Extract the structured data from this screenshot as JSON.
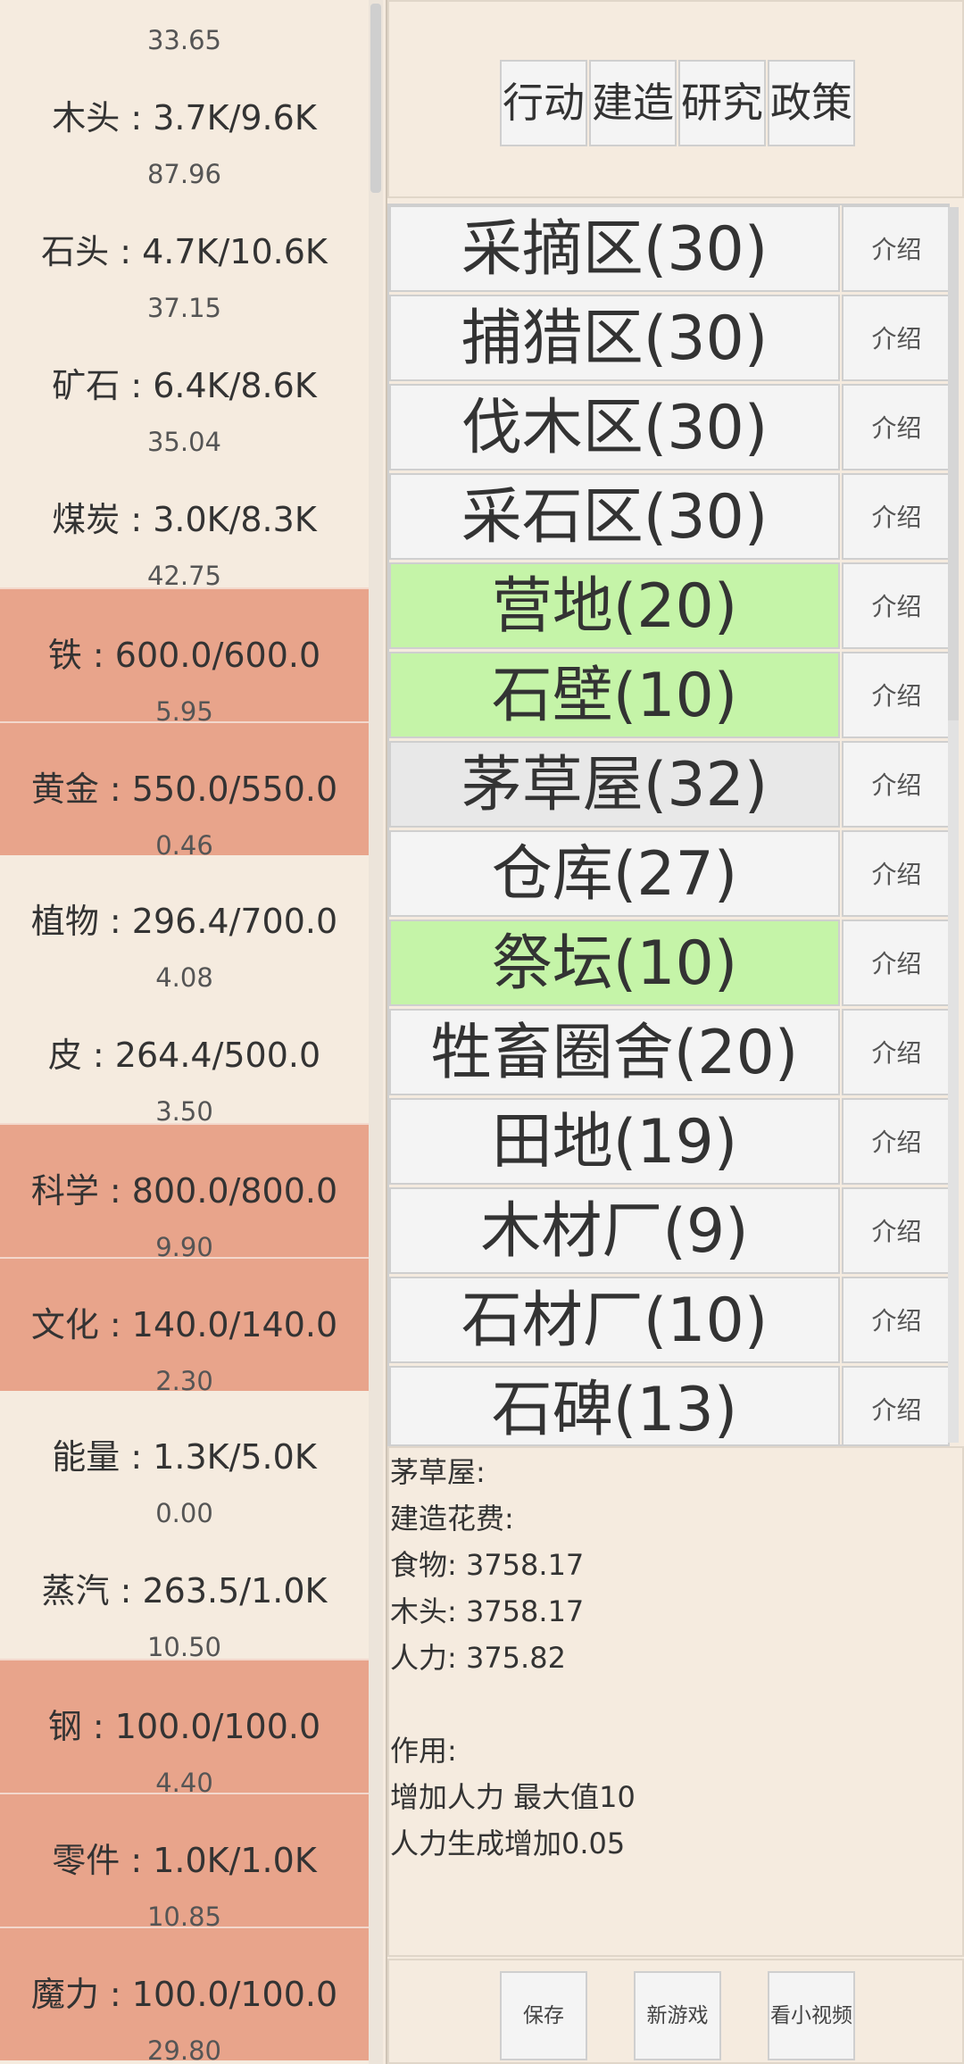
{
  "resources": {
    "top_rate": "33.65",
    "items": [
      {
        "label": "木头 : 3.7K/9.6K",
        "rate": "87.96",
        "full": false
      },
      {
        "label": "石头 : 4.7K/10.6K",
        "rate": "37.15",
        "full": false
      },
      {
        "label": "矿石 : 6.4K/8.6K",
        "rate": "35.04",
        "full": false
      },
      {
        "label": "煤炭 : 3.0K/8.3K",
        "rate": "42.75",
        "full": false
      },
      {
        "label": "铁 : 600.0/600.0",
        "rate": "5.95",
        "full": true
      },
      {
        "label": "黄金 : 550.0/550.0",
        "rate": "0.46",
        "full": true
      },
      {
        "label": "植物 : 296.4/700.0",
        "rate": "4.08",
        "full": false
      },
      {
        "label": "皮 : 264.4/500.0",
        "rate": "3.50",
        "full": false
      },
      {
        "label": "科学 : 800.0/800.0",
        "rate": "9.90",
        "full": true
      },
      {
        "label": "文化 : 140.0/140.0",
        "rate": "2.30",
        "full": true
      },
      {
        "label": "能量 : 1.3K/5.0K",
        "rate": "0.00",
        "full": false
      },
      {
        "label": "蒸汽 : 263.5/1.0K",
        "rate": "10.50",
        "full": false
      },
      {
        "label": "钢 : 100.0/100.0",
        "rate": "4.40",
        "full": true
      },
      {
        "label": "零件 : 1.0K/1.0K",
        "rate": "10.85",
        "full": true
      },
      {
        "label": "魔力 : 100.0/100.0",
        "rate": "29.80",
        "full": true
      }
    ]
  },
  "tabs": [
    "行动",
    "建造",
    "研究",
    "政策"
  ],
  "buildings": {
    "info_label": "介绍",
    "items": [
      {
        "name": "采摘区(30)",
        "state": "normal"
      },
      {
        "name": "捕猎区(30)",
        "state": "normal"
      },
      {
        "name": "伐木区(30)",
        "state": "normal"
      },
      {
        "name": "采石区(30)",
        "state": "normal"
      },
      {
        "name": "营地(20)",
        "state": "green"
      },
      {
        "name": "石壁(10)",
        "state": "green"
      },
      {
        "name": "茅草屋(32)",
        "state": "selected"
      },
      {
        "name": "仓库(27)",
        "state": "normal"
      },
      {
        "name": "祭坛(10)",
        "state": "green"
      },
      {
        "name": "牲畜圈舍(20)",
        "state": "normal"
      },
      {
        "name": "田地(19)",
        "state": "normal"
      },
      {
        "name": "木材厂(9)",
        "state": "normal"
      },
      {
        "name": "石材厂(10)",
        "state": "normal"
      },
      {
        "name": "石碑(13)",
        "state": "normal"
      }
    ]
  },
  "detail": {
    "lines": [
      "茅草屋:",
      "建造花费:",
      "食物: 3758.17",
      "木头: 3758.17",
      "人力: 375.82",
      "",
      "作用:",
      "增加人力 最大值10",
      "人力生成增加0.05"
    ]
  },
  "footer": {
    "save": "保存",
    "new_game": "新游戏",
    "watch_video": "看小视频"
  }
}
